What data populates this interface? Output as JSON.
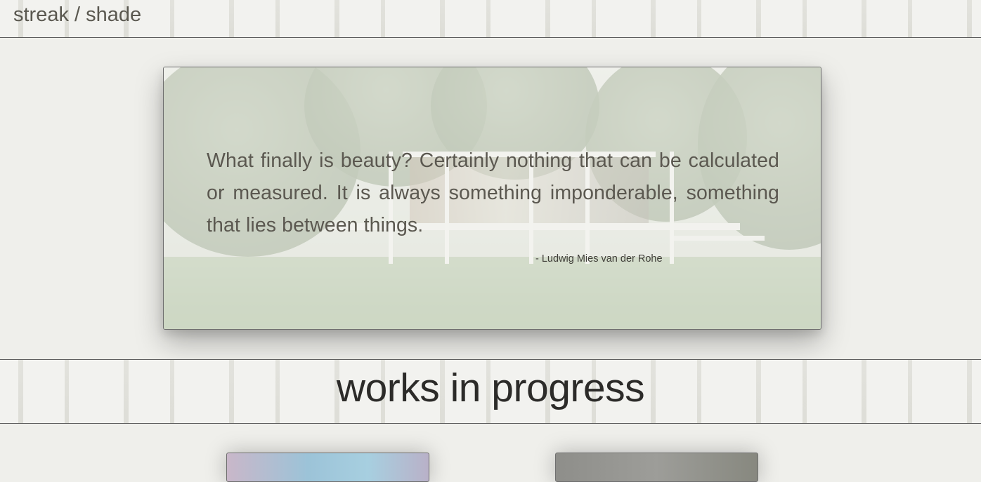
{
  "header": {
    "site_title": "streak / shade"
  },
  "quote": {
    "text": "What finally is beauty? Certainly nothing that can be calculated or measured. It is always something imponderable, something that lies between things.",
    "author": "- Ludwig Mies van der Rohe"
  },
  "works_section": {
    "heading": "works in progress"
  },
  "colors": {
    "page_background": "#efefeb",
    "rule_lines": "#5c5c5c",
    "heading_text": "#2c2b29",
    "quote_text": "#5b5850"
  }
}
